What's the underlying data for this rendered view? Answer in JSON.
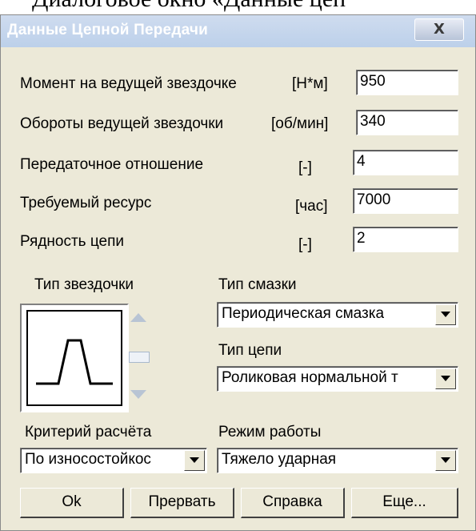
{
  "document_caption": "Диалоговое окно «Данные цеп",
  "window": {
    "title": "Данные Цепной Передачи",
    "close_glyph": "X"
  },
  "fields": [
    {
      "label": "Момент на ведущей звездочке",
      "unit": "[Н*м]",
      "value": "950"
    },
    {
      "label": "Обороты ведущей звездочки",
      "unit": "[об/мин]",
      "value": "340"
    },
    {
      "label": "Передаточное  отношение",
      "unit": "[-]",
      "value": "4"
    },
    {
      "label": "Требуемый  ресурс",
      "unit": "[час]",
      "value": "7000"
    },
    {
      "label": "Рядность цепи",
      "unit": "[-]",
      "value": "2"
    }
  ],
  "sprocket": {
    "label": "Тип звездочки",
    "icon": "trapezoid-tooth-icon"
  },
  "lubrication": {
    "label": "Тип смазки",
    "value": "Периодическая смазка"
  },
  "chain_type": {
    "label": "Тип цепи",
    "value": "Роликовая нормальной т"
  },
  "criterion": {
    "label": "Критерий расчёта",
    "value": "По износостойкос"
  },
  "mode": {
    "label": "Режим работы",
    "value": "Тяжело ударная"
  },
  "buttons": {
    "ok": "Ok",
    "abort": "Прервать",
    "help": "Справка",
    "more": "Еще..."
  },
  "colors": {
    "titlebar": "#bcd0ea",
    "dialog_bg": "#ece9d8"
  }
}
